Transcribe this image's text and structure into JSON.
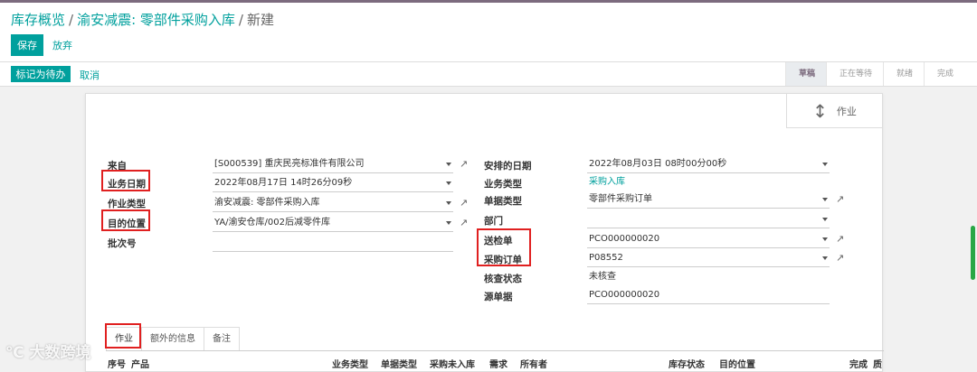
{
  "breadcrumb": {
    "items": [
      "库存概览",
      "渝安减震: 零部件采购入库"
    ],
    "current": "新建"
  },
  "actions": {
    "save": "保存",
    "discard": "放弃",
    "mark_todo": "标记为待办",
    "cancel": "取消"
  },
  "stages": [
    "草稿",
    "正在等待",
    "就绪",
    "完成"
  ],
  "smart_button": {
    "label": "作业",
    "icon": "updown-arrow-icon"
  },
  "left_fields": [
    {
      "label": "来自",
      "value": "[S000539] 重庆民亮标准件有限公司"
    },
    {
      "label": "业务日期",
      "value": "2022年08月17日 14时26分09秒"
    },
    {
      "label": "作业类型",
      "value": "渝安减震: 零部件采购入库"
    },
    {
      "label": "目的位置",
      "value": "YA/渝安仓库/002后减零件库"
    },
    {
      "label": "批次号",
      "value": ""
    }
  ],
  "right_fields": [
    {
      "label": "安排的日期",
      "value": "2022年08月03日 08时00分00秒"
    },
    {
      "label": "业务类型",
      "value": "采购入库"
    },
    {
      "label": "单据类型",
      "value": "零部件采购订单"
    },
    {
      "label": "部门",
      "value": ""
    },
    {
      "label": "送检单",
      "value": "PCO000000020"
    },
    {
      "label": "采购订单",
      "value": "P08552"
    },
    {
      "label": "核查状态",
      "value": "未核查"
    },
    {
      "label": "源单据",
      "value": "PCO000000020"
    }
  ],
  "tabs": [
    "作业",
    "额外的信息",
    "备注"
  ],
  "table_headers": [
    "序号",
    "产品",
    "业务类型",
    "单据类型",
    "采购未入库",
    "需求",
    "所有者",
    "库存状态",
    "目的位置",
    "完成",
    "质"
  ],
  "watermark": "大数跨境",
  "colors": {
    "accent": "#00a09d",
    "highlight": "#e02020",
    "brand": "#7c6b7e"
  }
}
